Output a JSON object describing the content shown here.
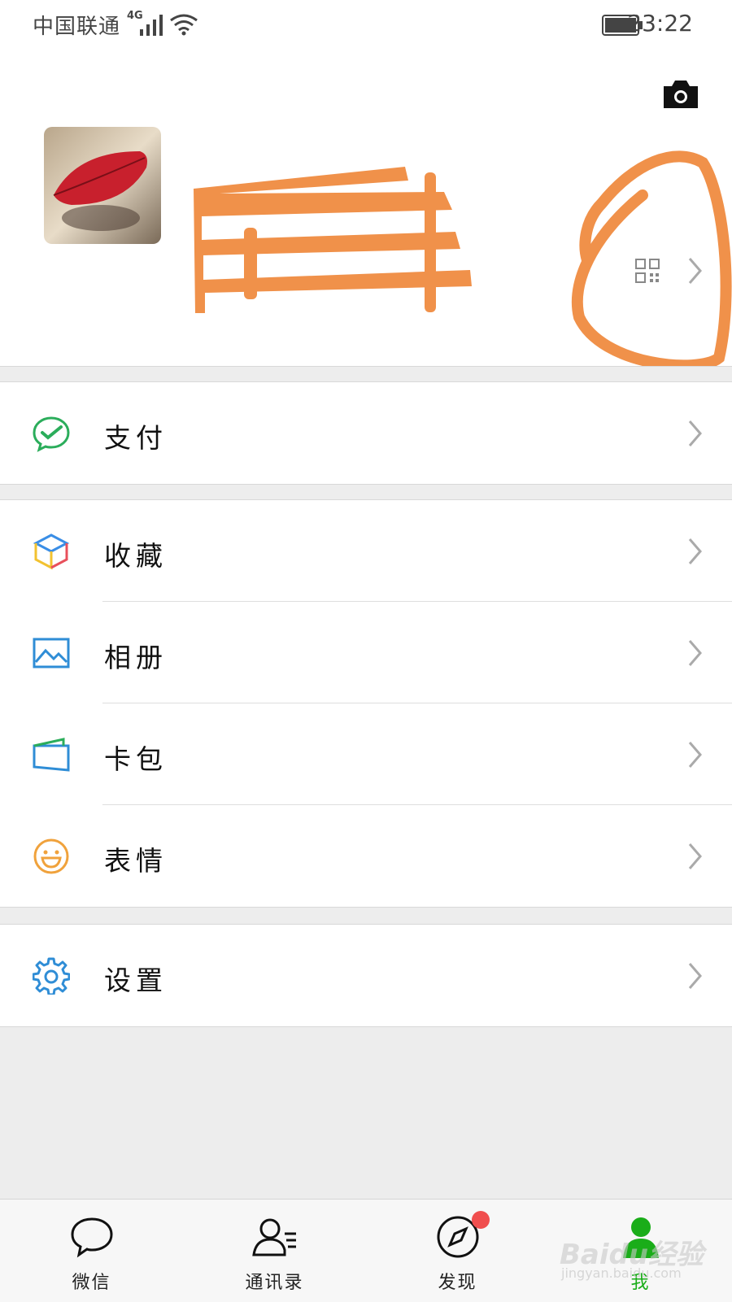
{
  "status_bar": {
    "carrier": "中国联通",
    "network": "4G",
    "time": "23:22"
  },
  "profile": {
    "avatar_icon": "red-leaf-photo",
    "qr_icon": "qr-code-icon"
  },
  "menu": {
    "pay": "支付",
    "favorites": "收藏",
    "album": "相册",
    "cards": "卡包",
    "stickers": "表情",
    "settings": "设置"
  },
  "tabs": {
    "chats": "微信",
    "contacts": "通讯录",
    "discover": "发现",
    "me": "我"
  },
  "watermark": {
    "logo": "Baidu经验",
    "url": "jingyan.baidu.com"
  },
  "colors": {
    "accent_green": "#1aad19",
    "scribble_orange": "#f0914a",
    "badge_red": "#f04e4e"
  }
}
